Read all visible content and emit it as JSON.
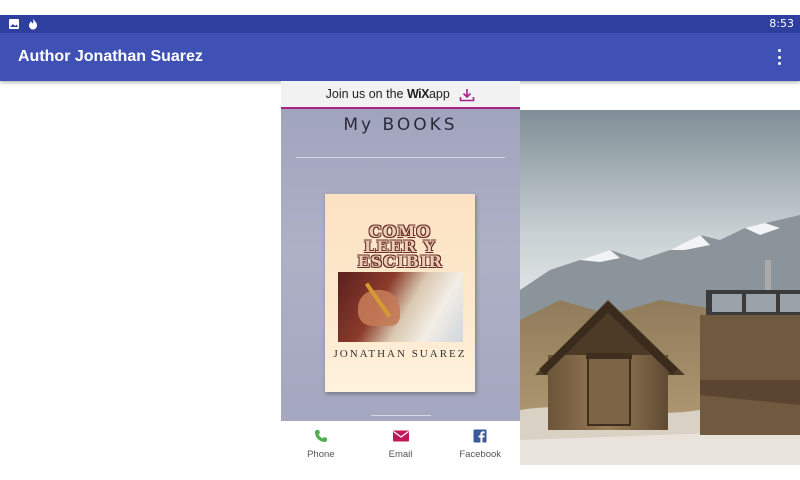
{
  "status_bar": {
    "time": "8:53",
    "icons": [
      "image-notification-icon",
      "fire-notification-icon"
    ]
  },
  "app_bar": {
    "title": "Author Jonathan Suarez",
    "menu_icon": "more-vert-icon"
  },
  "wix_banner": {
    "text_before": "Join us on the",
    "brand": "WiX",
    "text_after": "app",
    "icon": "download-icon",
    "accent_color": "#a6238a"
  },
  "books_section": {
    "heading": "My BOOKS",
    "book": {
      "title_lines": [
        "COMO",
        "LEER Y",
        "ESCIBIR"
      ],
      "author": "JONATHAN SUAREZ"
    }
  },
  "contact_bar": {
    "items": [
      {
        "label": "Phone",
        "icon": "phone-icon",
        "color": "#4caf50"
      },
      {
        "label": "Email",
        "icon": "email-icon",
        "color": "#c2185b"
      },
      {
        "label": "Facebook",
        "icon": "facebook-icon",
        "color": "#3b5998"
      }
    ]
  },
  "colors": {
    "status_bar": "#2f3f9f",
    "app_bar": "#3f51b5"
  }
}
